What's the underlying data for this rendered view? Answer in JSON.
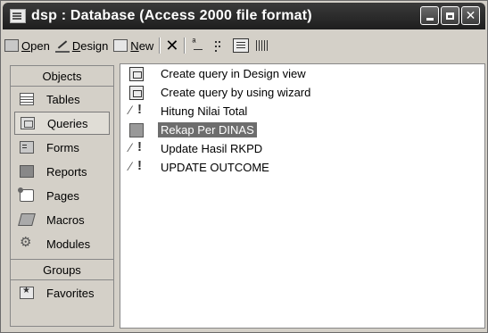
{
  "window": {
    "title": "dsp : Database (Access 2000 file format)",
    "buttons": {
      "minimize": "minimize",
      "maximize": "maximize",
      "close": "✕"
    }
  },
  "toolbar": {
    "open_label_u": "O",
    "open_label_rest": "pen",
    "design_label_u": "D",
    "design_label_rest": "esign",
    "new_label_u": "N",
    "new_label_rest": "ew",
    "delete_glyph": "✕"
  },
  "objects_pane": {
    "header": "Objects",
    "items": [
      {
        "label": "Tables",
        "icon": "table-icon"
      },
      {
        "label": "Queries",
        "icon": "query-icon",
        "selected": true
      },
      {
        "label": "Forms",
        "icon": "form-icon"
      },
      {
        "label": "Reports",
        "icon": "report-icon"
      },
      {
        "label": "Pages",
        "icon": "page-icon"
      },
      {
        "label": "Macros",
        "icon": "macro-icon"
      },
      {
        "label": "Modules",
        "icon": "module-icon"
      }
    ],
    "groups_header": "Groups",
    "groups": [
      {
        "label": "Favorites",
        "icon": "favorites-icon"
      }
    ]
  },
  "list_pane": {
    "items": [
      {
        "label": "Create query in Design view",
        "icon": "shortcut-icon"
      },
      {
        "label": "Create query by using wizard",
        "icon": "wizard-icon"
      },
      {
        "label": "Hitung Nilai Total",
        "icon": "update-query-icon"
      },
      {
        "label": "Rekap Per DINAS",
        "icon": "select-query-icon",
        "selected": true
      },
      {
        "label": "Update Hasil RKPD",
        "icon": "update-query-icon"
      },
      {
        "label": "UPDATE OUTCOME",
        "icon": "update-query-icon"
      }
    ]
  }
}
